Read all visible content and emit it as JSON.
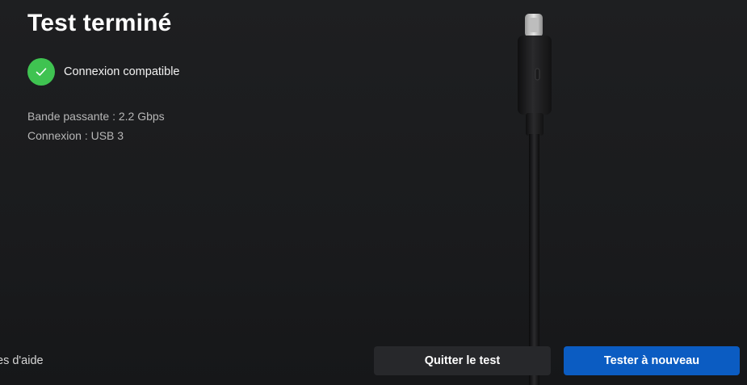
{
  "header": {
    "title": "Test terminé"
  },
  "status": {
    "icon": "check-icon",
    "label": "Connexion compatible",
    "color": "#3fc351"
  },
  "details": {
    "bandwidth": "Bande passante : 2.2 Gbps",
    "connection": "Connexion : USB 3"
  },
  "footer": {
    "help_link": "es d'aide",
    "quit_label": "Quitter le test",
    "retry_label": "Tester à nouveau",
    "accent": "#0b5cc2"
  },
  "illustration": {
    "icon": "usb-c-cable-icon"
  }
}
